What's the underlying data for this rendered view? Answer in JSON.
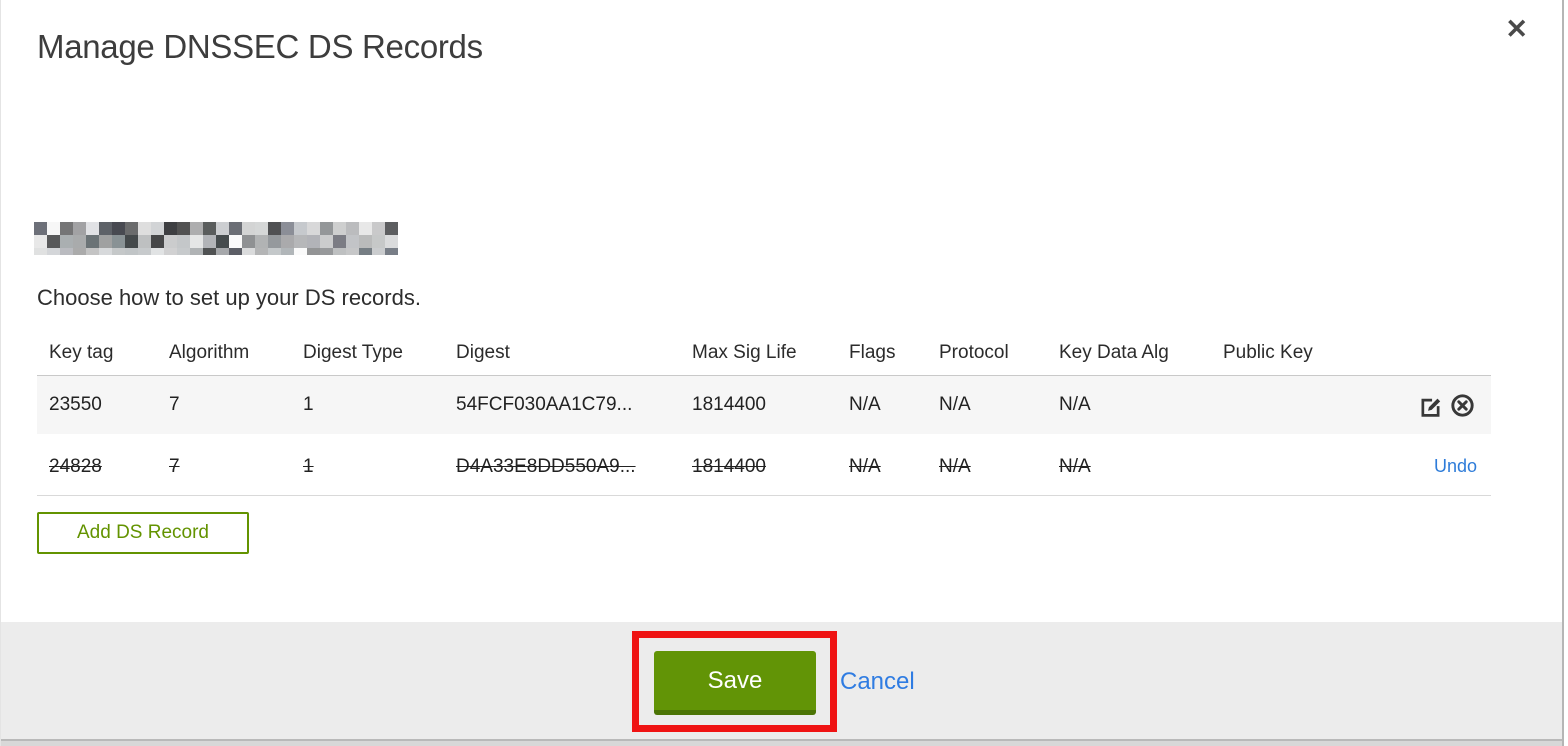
{
  "modal": {
    "title": "Manage DNSSEC DS Records",
    "domain_redacted": true,
    "instruction": "Choose how to set up your DS records.",
    "table": {
      "columns": [
        "Key tag",
        "Algorithm",
        "Digest Type",
        "Digest",
        "Max Sig Life",
        "Flags",
        "Protocol",
        "Key Data Alg",
        "Public Key"
      ],
      "rows": [
        {
          "key_tag": "23550",
          "algorithm": "7",
          "digest_type": "1",
          "digest": "54FCF030AA1C79...",
          "max_sig_life": "1814400",
          "flags": "N/A",
          "protocol": "N/A",
          "key_data_alg": "N/A",
          "public_key": "",
          "state": "normal"
        },
        {
          "key_tag": "24828",
          "algorithm": "7",
          "digest_type": "1",
          "digest": "D4A33E8DD550A9...",
          "max_sig_life": "1814400",
          "flags": "N/A",
          "protocol": "N/A",
          "key_data_alg": "N/A",
          "public_key": "",
          "state": "deleted",
          "undo_label": "Undo"
        }
      ]
    },
    "add_button_label": "Add DS Record",
    "footer": {
      "save_label": "Save",
      "cancel_label": "Cancel"
    }
  },
  "icons": {
    "close": "✕",
    "edit": "square-pencil-edit",
    "delete": "circle-x-delete"
  },
  "colors": {
    "accent_green": "#629406",
    "accent_green_dark": "#4b7405",
    "link_blue": "#2f7ce2",
    "annotation_red": "#ef1313",
    "footer_gray": "#ececec",
    "row_stripe": "#f6f6f6"
  }
}
